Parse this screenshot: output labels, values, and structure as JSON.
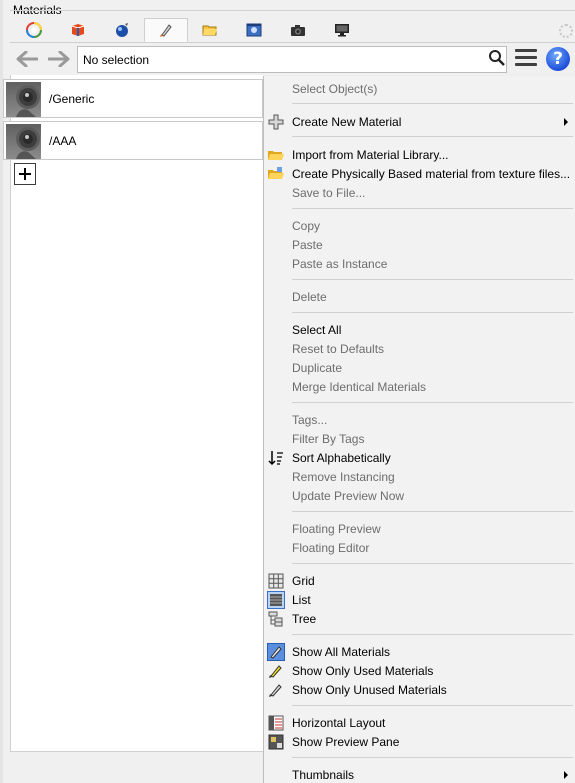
{
  "panel": {
    "title": "Materials"
  },
  "tabs": [
    {
      "icon": "color-wheel-icon",
      "active": false
    },
    {
      "icon": "materials-book-icon",
      "active": false
    },
    {
      "icon": "environment-globe-icon",
      "active": false
    },
    {
      "icon": "decal-brush-icon",
      "active": true
    },
    {
      "icon": "folder-icon",
      "active": false
    },
    {
      "icon": "texture-icon",
      "active": false
    },
    {
      "icon": "camera-icon",
      "active": false
    },
    {
      "icon": "monitor-icon",
      "active": false
    }
  ],
  "toolbar": {
    "selection_text": "No selection"
  },
  "materials": [
    {
      "name": "/Generic"
    },
    {
      "name": "/AAA"
    }
  ],
  "menu": {
    "select_objects": "Select Object(s)",
    "create_new_material": "Create New Material",
    "import_library": "Import from Material Library...",
    "create_pbr": "Create Physically Based material from texture files...",
    "save_to_file": "Save to File...",
    "copy": "Copy",
    "paste": "Paste",
    "paste_instance": "Paste as Instance",
    "delete": "Delete",
    "select_all": "Select All",
    "reset_defaults": "Reset to Defaults",
    "duplicate": "Duplicate",
    "merge_identical": "Merge Identical Materials",
    "tags": "Tags...",
    "filter_tags": "Filter By Tags",
    "sort_alpha": "Sort Alphabetically",
    "remove_instancing": "Remove Instancing",
    "update_preview": "Update Preview Now",
    "floating_preview": "Floating Preview",
    "floating_editor": "Floating Editor",
    "grid": "Grid",
    "list": "List",
    "tree": "Tree",
    "show_all": "Show All Materials",
    "show_used": "Show Only Used Materials",
    "show_unused": "Show Only Unused Materials",
    "horizontal_layout": "Horizontal Layout",
    "show_preview_pane": "Show Preview Pane",
    "thumbnails": "Thumbnails"
  }
}
